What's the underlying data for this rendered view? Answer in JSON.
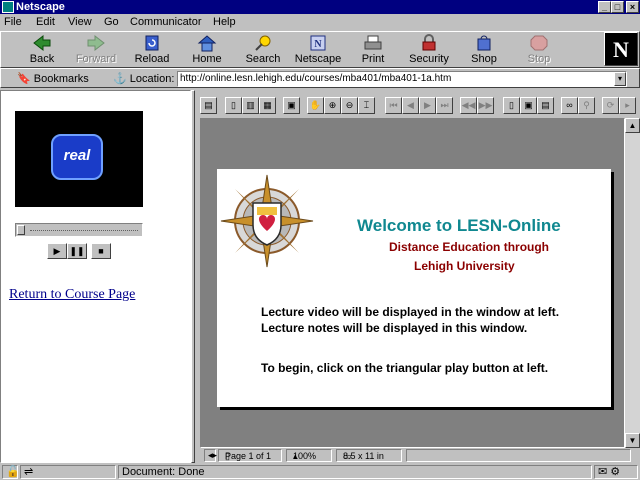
{
  "window": {
    "title": "Netscape"
  },
  "menu": [
    "File",
    "Edit",
    "View",
    "Go",
    "Communicator",
    "Help"
  ],
  "toolbar": [
    {
      "label": "Back",
      "icon": "back-arrow-icon",
      "enabled": true
    },
    {
      "label": "Forward",
      "icon": "forward-arrow-icon",
      "enabled": false
    },
    {
      "label": "Reload",
      "icon": "reload-icon",
      "enabled": true
    },
    {
      "label": "Home",
      "icon": "home-icon",
      "enabled": true
    },
    {
      "label": "Search",
      "icon": "search-icon",
      "enabled": true
    },
    {
      "label": "Netscape",
      "icon": "netscape-icon",
      "enabled": true
    },
    {
      "label": "Print",
      "icon": "print-icon",
      "enabled": true
    },
    {
      "label": "Security",
      "icon": "security-lock-icon",
      "enabled": true
    },
    {
      "label": "Shop",
      "icon": "shop-icon",
      "enabled": true
    },
    {
      "label": "Stop",
      "icon": "stop-icon",
      "enabled": false
    }
  ],
  "location_bar": {
    "bookmarks_label": "Bookmarks",
    "location_label": "Location:",
    "url": "http://online.lesn.lehigh.edu/courses/mba401/mba401-1a.htm"
  },
  "left_frame": {
    "player_logo": "real",
    "return_link": "Return to Course Page"
  },
  "pdf_page": {
    "title": "Welcome to LESN-Online",
    "subtitle_line1": "Distance Education through",
    "subtitle_line2": "Lehigh University",
    "line1": "Lecture video will be displayed in the window at left.",
    "line2": "Lecture notes will be displayed in this window.",
    "line3": "To begin, click on the triangular play button at left."
  },
  "pdf_status": {
    "page": "Page 1 of 1",
    "zoom": "100%",
    "size": "8.5 x 11 in"
  },
  "statusbar": {
    "text": "Document: Done"
  }
}
